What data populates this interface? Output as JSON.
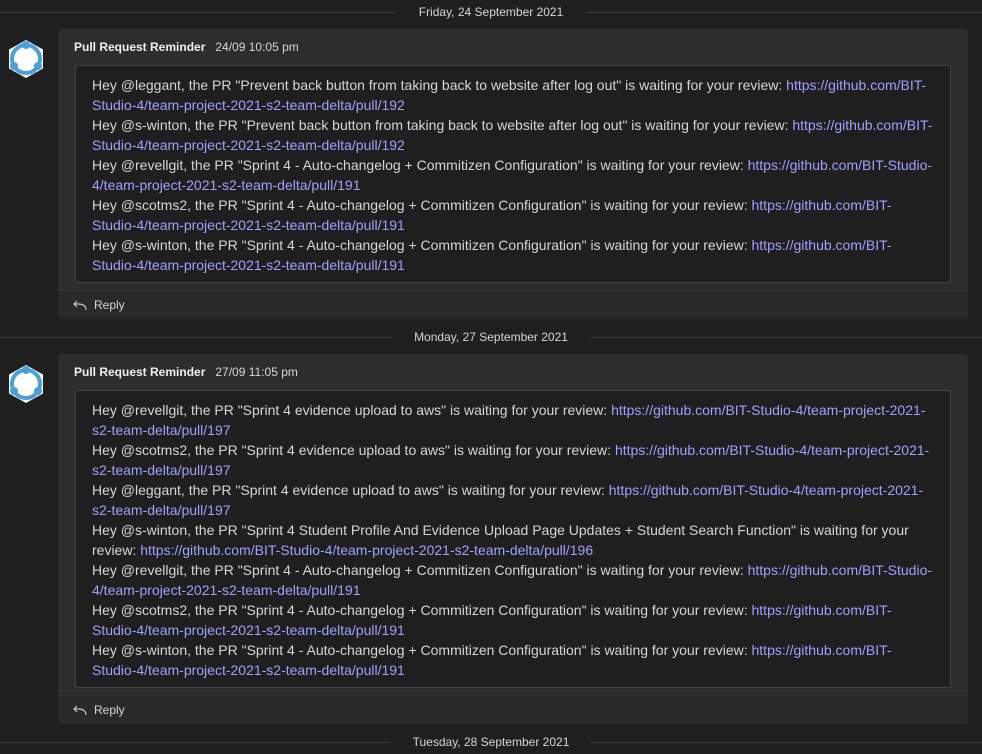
{
  "dates": [
    "Friday, 24 September 2021",
    "Monday, 27 September 2021",
    "Tuesday, 28 September 2021"
  ],
  "posts": [
    {
      "sender": "Pull Request Reminder",
      "time": "24/09 10:05 pm",
      "reply_label": "Reply",
      "lines": [
        {
          "text": "Hey @leggant, the PR \"Prevent back button from taking back to website after log out\" is waiting for your review: ",
          "link": "https://github.com/BIT-Studio-4/team-project-2021-s2-team-delta/pull/192"
        },
        {
          "text": "Hey @s-winton, the PR \"Prevent back button from taking back to website after log out\" is waiting for your review: ",
          "link": "https://github.com/BIT-Studio-4/team-project-2021-s2-team-delta/pull/192"
        },
        {
          "text": "Hey @revellgit, the PR \"Sprint 4 - Auto-changelog + Commitizen Configuration\" is waiting for your review: ",
          "link": "https://github.com/BIT-Studio-4/team-project-2021-s2-team-delta/pull/191"
        },
        {
          "text": "Hey @scotms2, the PR \"Sprint 4 - Auto-changelog + Commitizen Configuration\" is waiting for your review: ",
          "link": "https://github.com/BIT-Studio-4/team-project-2021-s2-team-delta/pull/191"
        },
        {
          "text": "Hey @s-winton, the PR \"Sprint 4 - Auto-changelog + Commitizen Configuration\" is waiting for your review: ",
          "link": "https://github.com/BIT-Studio-4/team-project-2021-s2-team-delta/pull/191"
        }
      ]
    },
    {
      "sender": "Pull Request Reminder",
      "time": "27/09 11:05 pm",
      "reply_label": "Reply",
      "lines": [
        {
          "text": "Hey @revellgit, the PR \"Sprint 4 evidence upload to aws\" is waiting for your review: ",
          "link": "https://github.com/BIT-Studio-4/team-project-2021-s2-team-delta/pull/197"
        },
        {
          "text": "Hey @scotms2, the PR \"Sprint 4 evidence upload to aws\" is waiting for your review: ",
          "link": "https://github.com/BIT-Studio-4/team-project-2021-s2-team-delta/pull/197"
        },
        {
          "text": "Hey @leggant, the PR \"Sprint 4 evidence upload to aws\" is waiting for your review: ",
          "link": "https://github.com/BIT-Studio-4/team-project-2021-s2-team-delta/pull/197"
        },
        {
          "text": "Hey @s-winton, the PR \"Sprint 4 Student Profile And Evidence Upload Page Updates + Student Search Function\" is waiting for your review: ",
          "link": "https://github.com/BIT-Studio-4/team-project-2021-s2-team-delta/pull/196"
        },
        {
          "text": "Hey @revellgit, the PR \"Sprint 4 - Auto-changelog + Commitizen Configuration\" is waiting for your review: ",
          "link": "https://github.com/BIT-Studio-4/team-project-2021-s2-team-delta/pull/191"
        },
        {
          "text": "Hey @scotms2, the PR \"Sprint 4 - Auto-changelog + Commitizen Configuration\" is waiting for your review: ",
          "link": "https://github.com/BIT-Studio-4/team-project-2021-s2-team-delta/pull/191"
        },
        {
          "text": "Hey @s-winton, the PR \"Sprint 4 - Auto-changelog + Commitizen Configuration\" is waiting for your review: ",
          "link": "https://github.com/BIT-Studio-4/team-project-2021-s2-team-delta/pull/191"
        }
      ]
    }
  ],
  "colors": {
    "background": "#1f1f1f",
    "card": "#2d2d2d",
    "link": "#9ea2ff"
  },
  "icons": {
    "avatar": "bot-avatar-icon",
    "reply": "reply-arrow-icon"
  }
}
